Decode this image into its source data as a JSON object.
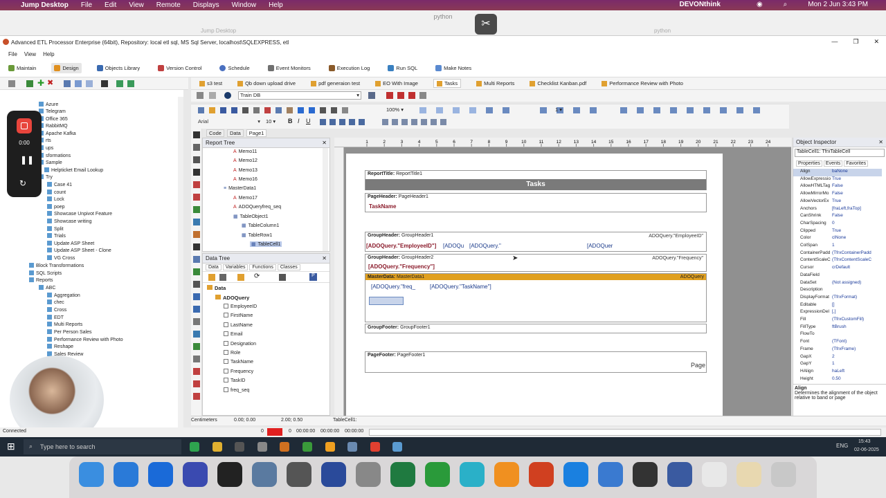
{
  "mac_menubar": {
    "app": "Jump Desktop",
    "menus": [
      "File",
      "Edit",
      "View",
      "Remote",
      "Displays",
      "Window",
      "Help"
    ],
    "status_app": "DEVONthink",
    "datetime": "Mon 2 Jun  3:43 PM"
  },
  "jump_window": {
    "title": "python",
    "left_title": "Jump Desktop",
    "right_title": "python"
  },
  "app_title": "Advanced ETL Processor Enterprise (64bit), Repository: local etl sql, MS Sql Server, localhost\\SQLEXPRESS, etl",
  "app_menu": [
    "File",
    "View",
    "Help"
  ],
  "main_tabs": [
    "Maintain",
    "Design",
    "Objects Library",
    "Version Control",
    "Schedule",
    "Event Monitors",
    "Execution Log",
    "Run SQL",
    "Make Notes"
  ],
  "left_tree": {
    "items": [
      "Azure",
      "Telegram",
      "Office 365",
      "RabbitMQ",
      "Apache Kafka",
      "rts",
      "ups",
      "sformations",
      "Sample",
      "Helpticket Email Lookup",
      "Try",
      "Case 41",
      "count",
      "Lock",
      "poep",
      "Showcase Unpivot Feature",
      "Showcase writing",
      "Split",
      "Trials",
      "Update ASP Sheet",
      "Update ASP Sheet - Clone",
      "VG Cross",
      "Block Transformations",
      "SQL Scripts",
      "Reports",
      "ABC",
      "Aggregation",
      "chec",
      "Cross",
      "EDT",
      "Multi Reports",
      "Per Person Sales",
      "Performance Review with Photo",
      "Reshape",
      "Sales Review"
    ]
  },
  "recorder": {
    "time": "0:00"
  },
  "doc_tabs": [
    "s3 test",
    "Qb down upload drive",
    "pdf generaion test",
    "EO With Image",
    "Tasks",
    "Multi Reports",
    "Checklist Kanban.pdf",
    "Performance Review with Photo"
  ],
  "db_select": "Train DB",
  "toolbar": {
    "zoom": "100%",
    "font": "Arial",
    "font_size": "10",
    "line_width": "1"
  },
  "designer_tabs": [
    "Code",
    "Data",
    "Page1"
  ],
  "report_tree": {
    "title": "Report Tree",
    "items": [
      "Memo11",
      "Memo12",
      "Memo13",
      "Memo16",
      "MasterData1",
      "Memo17",
      "ADOQueryfreq_seq",
      "TableObject1",
      "TableColumn1",
      "TableRow1",
      "TableCell1"
    ]
  },
  "data_tree": {
    "title": "Data Tree",
    "tabs": [
      "Data",
      "Variables",
      "Functions",
      "Classes"
    ],
    "root": "Data",
    "query": "ADOQuery",
    "fields": [
      "EmployeeID",
      "FirstName",
      "LastName",
      "Email",
      "Designation",
      "Role",
      "TaskName",
      "Frequency",
      "TaskID",
      "freq_seq"
    ]
  },
  "ruler_marks": [
    "1",
    "2",
    "3",
    "4",
    "5",
    "6",
    "7",
    "8",
    "9",
    "10",
    "11",
    "12",
    "13",
    "14",
    "15",
    "16",
    "17",
    "18",
    "19",
    "20",
    "21",
    "22",
    "23",
    "24"
  ],
  "bands": {
    "report_title": {
      "label": "ReportTitle:",
      "name": "ReportTitle1",
      "text": "Tasks"
    },
    "page_header": {
      "label": "PageHeader:",
      "name": "PageHeader1",
      "text": "TaskName"
    },
    "group_header1": {
      "label": "GroupHeader:",
      "name": "GroupHeader1",
      "cond": "ADOQuery.\"EmployeeID\"",
      "f1": "[ADOQuery.\"EmployeeID\"]",
      "f2": "[ADOQu",
      "f3": "[ADOQuery.\"",
      "f4": "[ADOQuer"
    },
    "group_header2": {
      "label": "GroupHeader:",
      "name": "GroupHeader2",
      "cond": "ADOQuery.\"Frequency\"",
      "f1": "[ADOQuery.\"Frequency\"]"
    },
    "master_data": {
      "label": "MasterData:",
      "name": "MasterData1",
      "ds": "ADOQuery",
      "f1": "[ADOQuery.\"freq_",
      "f2": "[ADOQuery.\"TaskName\"]"
    },
    "group_footer": {
      "label": "GroupFooter:",
      "name": "GroupFooter1"
    },
    "page_footer": {
      "label": "PageFooter:",
      "name": "PageFooter1",
      "text": "Page"
    }
  },
  "object_inspector": {
    "title": "Object Inspector",
    "selected": "TableCell1: TfrxTableCell",
    "tabs": [
      "Properties",
      "Events",
      "Favorites"
    ],
    "props": [
      [
        "Align",
        "baNone"
      ],
      [
        "AllowExpressio",
        "True"
      ],
      [
        "AllowHTMLTag",
        "False"
      ],
      [
        "AllowMirrorMo",
        "False"
      ],
      [
        "AllowVectorEx",
        "True"
      ],
      [
        "Anchors",
        "[fraLeft,fraTop]"
      ],
      [
        "CanShrink",
        "False"
      ],
      [
        "CharSpacing",
        "0"
      ],
      [
        "Clipped",
        "True"
      ],
      [
        "Color",
        "clNone"
      ],
      [
        "ColSpan",
        "1"
      ],
      [
        "ContainerPadd",
        "(TfrxContainerPadd"
      ],
      [
        "ContentScaleC",
        "(TfrxContentScaleC"
      ],
      [
        "Cursor",
        "crDefault"
      ],
      [
        "DataField",
        ""
      ],
      [
        "DataSet",
        "(Not assigned)"
      ],
      [
        "Description",
        ""
      ],
      [
        "DisplayFormat",
        "(TfrxFormat)"
      ],
      [
        "Editable",
        "[]"
      ],
      [
        "ExpressionDel",
        "[,]"
      ],
      [
        "Fill",
        "(TfrxCustomFill)"
      ],
      [
        "FillType",
        "ftBrush"
      ],
      [
        "FlowTo",
        ""
      ],
      [
        "Font",
        "(TFont)"
      ],
      [
        "Frame",
        "(TfrxFrame)"
      ],
      [
        "GapX",
        "2"
      ],
      [
        "GapY",
        "1"
      ],
      [
        "HAlign",
        "haLeft"
      ],
      [
        "Height",
        "0.50"
      ]
    ],
    "help_title": "Align",
    "help_text": "Determines the alignment of the object relative to band or page"
  },
  "status_bar": {
    "units": "Centimeters",
    "pos": "0.00; 0.00",
    "size": "2.00; 0.50",
    "object": "TableCell1:"
  },
  "progress_bar": {
    "left": "Connected",
    "count1": "0",
    "count2": "0",
    "t1": "00:00:00",
    "t2": "00:00:00",
    "t3": "00:00:00"
  },
  "win_taskbar": {
    "search_placeholder": "Type here to search",
    "time": "15:43",
    "date": "02-06-2025",
    "lang": "ENG"
  }
}
